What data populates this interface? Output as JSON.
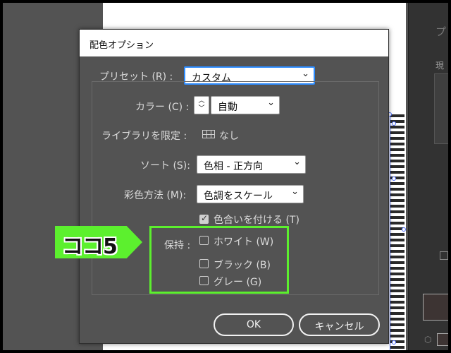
{
  "dialog": {
    "title": "配色オプション",
    "preset": {
      "label": "プリセット (R) :",
      "value": "カスタム"
    },
    "colors": {
      "label": "カラー (C) :",
      "value": "自動"
    },
    "library": {
      "label": "ライブラリを限定 :",
      "value": "なし"
    },
    "sort": {
      "label": "ソート (S):",
      "value": "色相 - 正方向"
    },
    "recolor_method": {
      "label": "彩色方法 (M):",
      "value": "色調をスケール"
    },
    "colorize": {
      "label": "色合いを付ける (T)",
      "checked": true
    },
    "preserve": {
      "label": "保持 :",
      "white": {
        "label": "ホワイト (W)",
        "checked": false
      },
      "black": {
        "label": "ブラック (B)",
        "checked": false
      },
      "gray": {
        "label": "グレー (G)",
        "checked": false
      }
    },
    "ok_label": "OK",
    "cancel_label": "キャンセル"
  },
  "annotation": {
    "text": "ココ5",
    "color": "#5cf02e"
  },
  "right_panel": {
    "text1": "プ",
    "text2": "現"
  },
  "icons": {
    "chevron": "chevron-down-icon",
    "stepper": "stepper-arrows-icon",
    "library": "grid-swatch-icon",
    "check": "checkmark-icon"
  }
}
